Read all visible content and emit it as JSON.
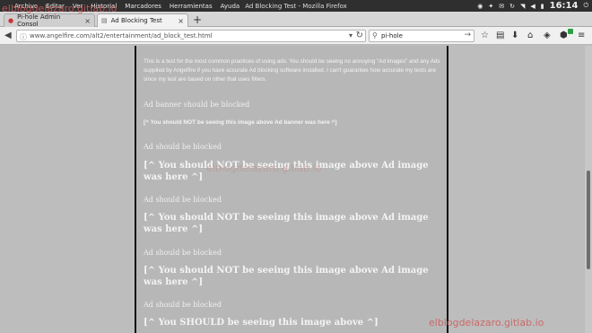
{
  "system_bar": {
    "menus": [
      "Archivo",
      "Editar",
      "Ver",
      "Historial",
      "Marcadores",
      "Herramientas",
      "Ayuda"
    ],
    "window_title": "Ad Blocking Test - Mozilla Firefox",
    "clock": "16:14"
  },
  "tabs": [
    {
      "label": "Pi-hole Admin Consol",
      "active": false
    },
    {
      "label": "Ad Blocking Test",
      "active": true
    }
  ],
  "navbar": {
    "url": "www.angelfire.com/alt2/entertainment/ad_block_test.html",
    "search_value": "pi-hole"
  },
  "page": {
    "intro": "This is a test for the most common practices of using ads. You should be seeing no annoying \"Ad images\" and any Ads supplied by Angelfire if you have accurate Ad blocking software installed. I can't guarantee how accurate my tests are since my test are based on other that uses filters.",
    "sections": [
      {
        "label": "Ad banner should be blocked",
        "message": "[^ You should NOT be seeing this image above Ad banner was here ^]"
      },
      {
        "label": "Ad should be blocked",
        "message": "[^ You should NOT be seeing this image above Ad image was here ^]"
      },
      {
        "label": "Ad should be blocked",
        "message": "[^ You should NOT be seeing this image above Ad image was here ^]"
      },
      {
        "label": "Ad should be blocked",
        "message": "[^ You should NOT be seeing this image above Ad image was here ^]"
      },
      {
        "label": "Ad should be blocked",
        "message": "[^ You SHOULD be seeing this image above ^]"
      }
    ]
  },
  "watermark": "elblogdelazaro.gitlab.io",
  "colors": {
    "accent": "#2ea043",
    "watermark": "#cd5c5c"
  }
}
